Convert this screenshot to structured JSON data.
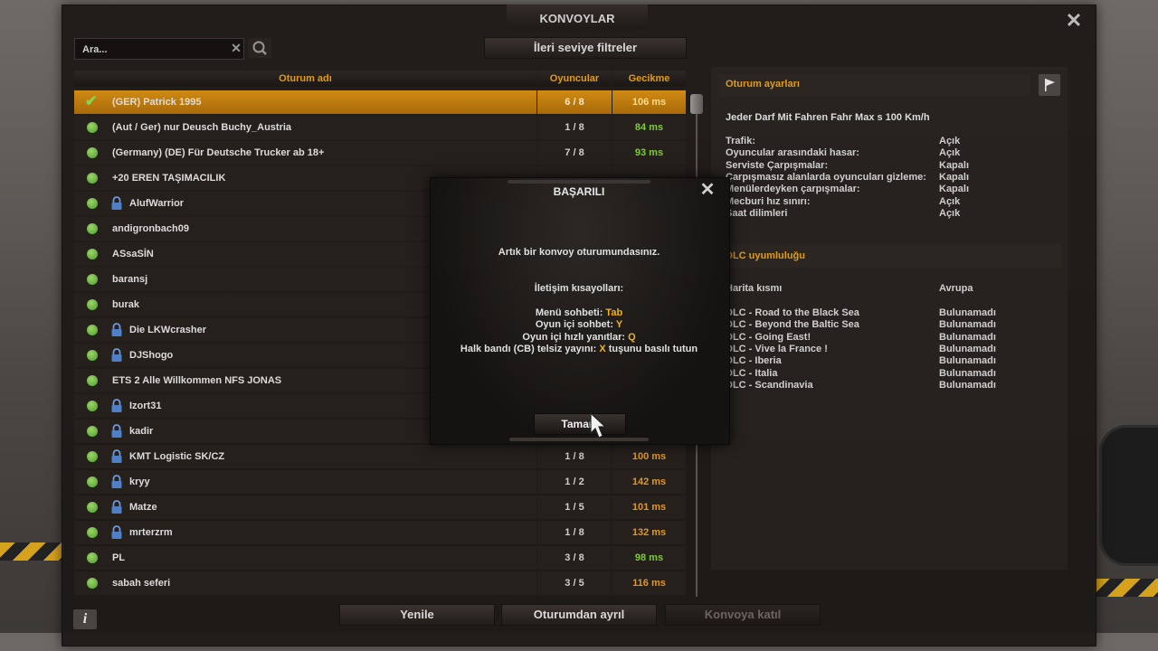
{
  "window": {
    "title": "KONVOYLAR"
  },
  "search": {
    "placeholder": "Ara..."
  },
  "filters": {
    "advanced_label": "İleri seviye filtreler"
  },
  "table": {
    "headers": {
      "name": "Oturum adı",
      "players": "Oyuncular",
      "delay": "Gecikme"
    },
    "rows": [
      {
        "name": "(GER) Patrick 1995",
        "players": "6 / 8",
        "delay": "106 ms",
        "locked": false,
        "selected": true
      },
      {
        "name": "(Aut / Ger) nur Deusch     Buchy_Austria",
        "players": "1 / 8",
        "delay": "84 ms",
        "locked": false
      },
      {
        "name": "(Germany) (DE) Für Deutsche Trucker  ab 18+",
        "players": "7 / 8",
        "delay": "93 ms",
        "locked": false
      },
      {
        "name": "+20  EREN TAŞIMACILIK",
        "players": "",
        "delay": "",
        "locked": false
      },
      {
        "name": "AlufWarrior",
        "players": "",
        "delay": "",
        "locked": true
      },
      {
        "name": "andigronbach09",
        "players": "",
        "delay": "",
        "locked": false
      },
      {
        "name": "ASsaSİN",
        "players": "",
        "delay": "",
        "locked": false
      },
      {
        "name": "baransj",
        "players": "",
        "delay": "",
        "locked": false
      },
      {
        "name": "burak",
        "players": "",
        "delay": "",
        "locked": false
      },
      {
        "name": "Die LKWcrasher",
        "players": "",
        "delay": "",
        "locked": true
      },
      {
        "name": "DJShogo",
        "players": "",
        "delay": "",
        "locked": true
      },
      {
        "name": "ETS 2 Alle Willkommen NFS JONAS",
        "players": "",
        "delay": "",
        "locked": false
      },
      {
        "name": "Izort31",
        "players": "",
        "delay": "",
        "locked": true
      },
      {
        "name": "kadir",
        "players": "",
        "delay": "",
        "locked": true
      },
      {
        "name": "KMT Logistic SK/CZ",
        "players": "1 / 8",
        "delay": "100 ms",
        "locked": true
      },
      {
        "name": "kryy",
        "players": "1 / 2",
        "delay": "142 ms",
        "locked": true
      },
      {
        "name": "Matze",
        "players": "1 / 5",
        "delay": "101 ms",
        "locked": true
      },
      {
        "name": "mrterzrm",
        "players": "1 / 8",
        "delay": "132 ms",
        "locked": true
      },
      {
        "name": "PL",
        "players": "3 / 8",
        "delay": "98 ms",
        "locked": false
      },
      {
        "name": "sabah seferi",
        "players": "3 / 5",
        "delay": "116 ms",
        "locked": false
      }
    ]
  },
  "session": {
    "header": "Oturum ayarları",
    "name": "Jeder Darf Mit Fahren  Fahr Max s 100 Km/h",
    "settings": [
      {
        "label": "Trafik:",
        "value": "Açık"
      },
      {
        "label": "Oyuncular arasındaki hasar:",
        "value": "Açık"
      },
      {
        "label": "Serviste Çarpışmalar:",
        "value": "Kapalı"
      },
      {
        "label": "Çarpışmasız alanlarda oyuncuları gizleme:",
        "value": "Kapalı"
      },
      {
        "label": "Menülerdeyken çarpışmalar:",
        "value": "Kapalı"
      },
      {
        "label": "Mecburi hız sınırı:",
        "value": "Açık"
      },
      {
        "label": "Saat dilimleri",
        "value": "Açık"
      }
    ]
  },
  "dlc": {
    "header": "DLC uyumluluğu",
    "map_label": "Harita kısmı",
    "map_value": "Avrupa",
    "items": [
      {
        "label": "DLC - Road to the Black Sea",
        "value": "Bulunamadı"
      },
      {
        "label": "DLC - Beyond the Baltic Sea",
        "value": "Bulunamadı"
      },
      {
        "label": "DLC - Going East!",
        "value": "Bulunamadı"
      },
      {
        "label": "DLC - Vive la France !",
        "value": "Bulunamadı"
      },
      {
        "label": "DLC - Iberia",
        "value": "Bulunamadı"
      },
      {
        "label": "DLC - Italia",
        "value": "Bulunamadı"
      },
      {
        "label": "DLC - Scandinavia",
        "value": "Bulunamadı"
      }
    ]
  },
  "buttons": {
    "refresh": "Yenile",
    "leave": "Oturumdan ayrıl",
    "join": "Konvoya katıl",
    "info": "i"
  },
  "modal": {
    "title": "BAŞARILI",
    "message": "Artık bir konvoy oturumundasınız.",
    "shortcuts_title": "İletişim kısayolları:",
    "shortcuts": [
      {
        "label": "Menü sohbeti: ",
        "key": "Tab",
        "suffix": ""
      },
      {
        "label": "Oyun içi sohbet: ",
        "key": "Y",
        "suffix": ""
      },
      {
        "label": "Oyun içi hızlı yanıtlar: ",
        "key": "Q",
        "suffix": ""
      },
      {
        "label": "Halk bandı (CB) telsiz yayını: ",
        "key": "X",
        "suffix": " tuşunu basılı tutun"
      }
    ],
    "ok_label": "Tamam"
  },
  "colors": {
    "accent": "#e09b1c",
    "selected_row": "#c4800f",
    "latency_good": "#7ccc3a",
    "latency_warn": "#e0962a",
    "online_dot": "#6cbf3a"
  }
}
